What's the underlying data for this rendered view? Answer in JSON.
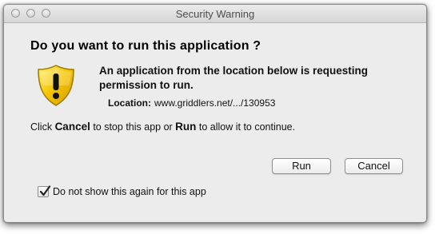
{
  "window": {
    "title": "Security Warning"
  },
  "dialog": {
    "heading": "Do you want to run this application ?",
    "message": "An application from the location below is requesting permission to run.",
    "location_label": "Location:",
    "location_value": "www.griddlers.net/.../130953",
    "instruction": {
      "part1": "Click ",
      "cancel_word": "Cancel",
      "part2": " to stop this app or ",
      "run_word": "Run",
      "part3": " to allow it to continue."
    },
    "buttons": {
      "run_label": "Run",
      "cancel_label": "Cancel"
    },
    "checkbox": {
      "label": "Do not show this again for this app",
      "checked": true
    },
    "icon": "warning-shield-icon",
    "colors": {
      "shield_yellow": "#f5c400",
      "shield_border": "#9a7a00",
      "background": "#ececec"
    }
  }
}
